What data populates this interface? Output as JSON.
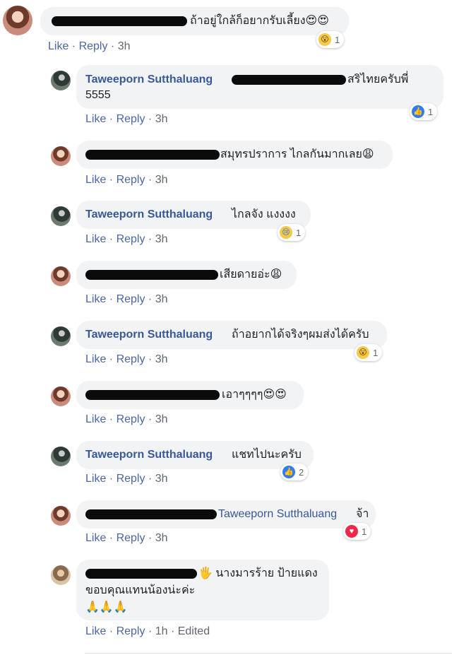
{
  "comments": [
    {
      "text": "ถ้าอยู่ใกล้ก็อยากรับเลี้ยง😍😍",
      "reaction": {
        "icon": "wow-reaction-icon",
        "count": "1"
      },
      "actions": {
        "like": "Like",
        "reply": "Reply",
        "time": "3h"
      }
    },
    {
      "author": "Taweeporn Sutthaluang",
      "text": "สริไทยครับพี่",
      "text2": "5555",
      "reaction": {
        "icon": "like-reaction-icon",
        "count": "1"
      },
      "actions": {
        "like": "Like",
        "reply": "Reply",
        "time": "3h"
      }
    },
    {
      "text": "สมุทรปราการ ไกลกันมากเลย😩",
      "actions": {
        "like": "Like",
        "reply": "Reply",
        "time": "3h"
      }
    },
    {
      "author": "Taweeporn Sutthaluang",
      "text": "ไกลจัง แงงงง",
      "reaction": {
        "icon": "sad-reaction-icon",
        "count": "1"
      },
      "actions": {
        "like": "Like",
        "reply": "Reply",
        "time": "3h"
      }
    },
    {
      "text": "เสียดายอ่ะ😩",
      "actions": {
        "like": "Like",
        "reply": "Reply",
        "time": "3h"
      }
    },
    {
      "author": "Taweeporn Sutthaluang",
      "text": "ถ้าอยากได้จริงๆผมส่งได้ครับ",
      "reaction": {
        "icon": "wow-reaction-icon",
        "count": "1"
      },
      "actions": {
        "like": "Like",
        "reply": "Reply",
        "time": "3h"
      }
    },
    {
      "text": "เอาๆๆๆๆ😍😍",
      "actions": {
        "like": "Like",
        "reply": "Reply",
        "time": "3h"
      }
    },
    {
      "author": "Taweeporn Sutthaluang",
      "text": "แชทไปนะครับ",
      "reaction": {
        "icon": "like-reaction-icon",
        "count": "2"
      },
      "actions": {
        "like": "Like",
        "reply": "Reply",
        "time": "3h"
      }
    },
    {
      "mention": "Taweeporn Sutthaluang",
      "text": "จ้า",
      "reaction": {
        "icon": "love-reaction-icon",
        "count": "1"
      },
      "actions": {
        "like": "Like",
        "reply": "Reply",
        "time": "3h"
      }
    },
    {
      "text": "🖐 นางมารร้าย ป้ายแดง",
      "text2": "ขอบคุณแทนน้องน่ะค่ะ",
      "text3": "🙏🙏🙏",
      "actions": {
        "like": "Like",
        "reply": "Reply",
        "time": "1h",
        "edited": "Edited"
      }
    }
  ],
  "colors": {
    "name": "#385898",
    "bubble": "#f2f3f5",
    "link": "#4b67a1",
    "like": "#2f7cf6",
    "love": "#f0284a"
  }
}
